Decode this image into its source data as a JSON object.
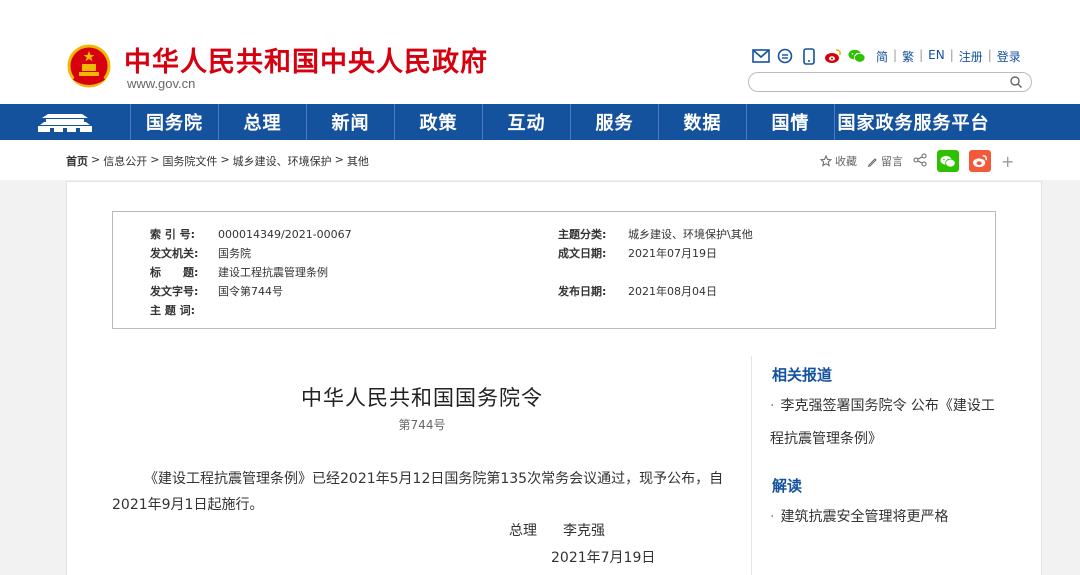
{
  "header": {
    "site_title": "中华人民共和国中央人民政府",
    "site_url": "www.gov.cn",
    "lang_links": [
      "简",
      "繁",
      "EN",
      "注册",
      "登录"
    ],
    "search_placeholder": ""
  },
  "nav": {
    "items": [
      "国务院",
      "总理",
      "新闻",
      "政策",
      "互动",
      "服务",
      "数据",
      "国情",
      "国家政务服务平台"
    ]
  },
  "breadcrumb": {
    "home": "首页",
    "items": [
      "信息公开",
      "国务院文件",
      "城乡建设、环境保护",
      "其他"
    ],
    "sep": ">"
  },
  "share": {
    "favorite": "收藏",
    "comment": "留言",
    "plus": "+"
  },
  "meta": {
    "index_label": "索 引 号:",
    "index_value": "000014349/2021-00067",
    "category_label": "主题分类:",
    "category_value": "城乡建设、环境保护\\其他",
    "issuer_label": "发文机关:",
    "issuer_value": "国务院",
    "created_label": "成文日期:",
    "created_value": "2021年07月19日",
    "title_label": "标　　题:",
    "title_value": "建设工程抗震管理条例",
    "docno_label": "发文字号:",
    "docno_value": "国令第744号",
    "published_label": "发布日期:",
    "published_value": "2021年08月04日",
    "keywords_label": "主 题 词:",
    "keywords_value": ""
  },
  "doc": {
    "title": "中华人民共和国国务院令",
    "number": "第744号",
    "body": "《建设工程抗震管理条例》已经2021年5月12日国务院第135次常务会议通过，现予公布，自2021年9月1日起施行。",
    "signer_title": "总理",
    "signer_name": "李克强",
    "date": "2021年7月19日"
  },
  "sidebar": {
    "related_heading": "相关报道",
    "related_items": [
      "李克强签署国务院令 公布《建设工程抗震管理条例》"
    ],
    "interpret_heading": "解读",
    "interpret_items": [
      "建筑抗震安全管理将更严格"
    ]
  },
  "colors": {
    "brand_red": "#d6000f",
    "nav_blue": "#15529e",
    "wechat_green": "#2dc100",
    "weibo_orange": "#f25a3a"
  }
}
